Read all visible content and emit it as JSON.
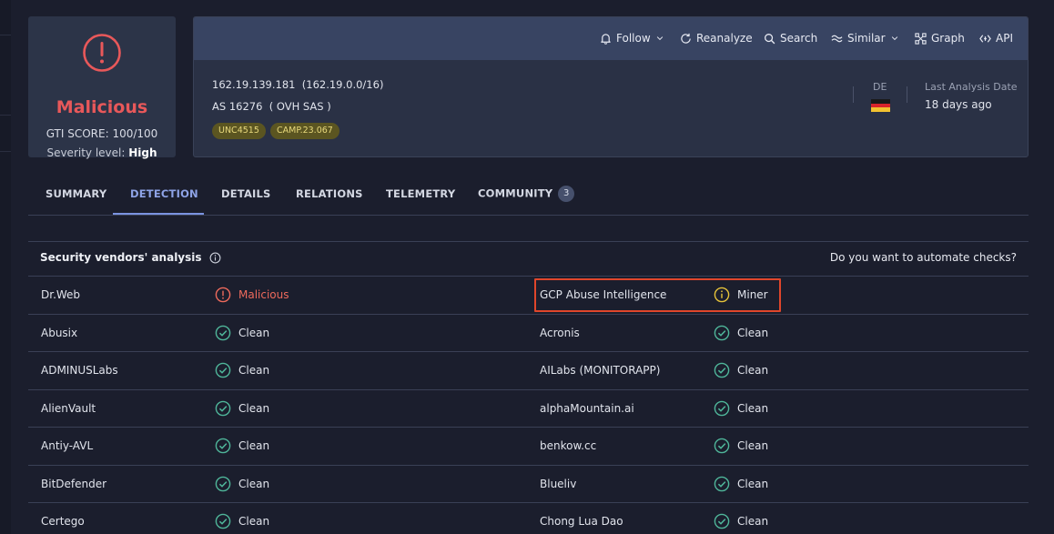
{
  "score_card": {
    "verdict": "Malicious",
    "gti_score": "GTI SCORE: 100/100",
    "severity_label": "Severity level:",
    "severity_value": "High",
    "accent_color": "#e8585a",
    "icon": "alert-circle-icon"
  },
  "toolbar": {
    "items": [
      {
        "label": "Follow",
        "icon": "bell-icon"
      },
      {
        "label": "Reanalyze",
        "icon": "refresh-icon"
      },
      {
        "label": "Search",
        "icon": "search-icon"
      },
      {
        "label": "Similar",
        "icon": "similar-icon"
      },
      {
        "label": "Graph",
        "icon": "graph-icon"
      },
      {
        "label": "API",
        "icon": "api-icon"
      }
    ]
  },
  "header": {
    "ip_line": "162.19.139.181  (162.19.0.0/16)",
    "as_line": "AS 16276  ( OVH SAS )",
    "tags": [
      "UNC4515",
      "CAMP.23.067"
    ],
    "country_code": "DE",
    "last_analysis_label": "Last Analysis Date",
    "last_analysis_value": "18 days ago"
  },
  "tabs": [
    {
      "label": "SUMMARY",
      "active": false
    },
    {
      "label": "DETECTION",
      "active": true
    },
    {
      "label": "DETAILS",
      "active": false
    },
    {
      "label": "RELATIONS",
      "active": false
    },
    {
      "label": "TELEMETRY",
      "active": false
    },
    {
      "label": "COMMUNITY",
      "active": false,
      "badge": "3"
    }
  ],
  "vendors": {
    "title": "Security vendors' analysis",
    "automate_link": "Do you want to automate checks?",
    "rows": [
      {
        "left": {
          "name": "Dr.Web",
          "result": "Malicious",
          "status": "malicious"
        },
        "right": {
          "name": "GCP Abuse Intelligence",
          "result": "Miner",
          "status": "suspicious"
        }
      },
      {
        "left": {
          "name": "Abusix",
          "result": "Clean",
          "status": "clean"
        },
        "right": {
          "name": "Acronis",
          "result": "Clean",
          "status": "clean"
        }
      },
      {
        "left": {
          "name": "ADMINUSLabs",
          "result": "Clean",
          "status": "clean"
        },
        "right": {
          "name": "AILabs (MONITORAPP)",
          "result": "Clean",
          "status": "clean"
        }
      },
      {
        "left": {
          "name": "AlienVault",
          "result": "Clean",
          "status": "clean"
        },
        "right": {
          "name": "alphaMountain.ai",
          "result": "Clean",
          "status": "clean"
        }
      },
      {
        "left": {
          "name": "Antiy-AVL",
          "result": "Clean",
          "status": "clean"
        },
        "right": {
          "name": "benkow.cc",
          "result": "Clean",
          "status": "clean"
        }
      },
      {
        "left": {
          "name": "BitDefender",
          "result": "Clean",
          "status": "clean"
        },
        "right": {
          "name": "Blueliv",
          "result": "Clean",
          "status": "clean"
        }
      },
      {
        "left": {
          "name": "Certego",
          "result": "Clean",
          "status": "clean"
        },
        "right": {
          "name": "Chong Lua Dao",
          "result": "Clean",
          "status": "clean"
        }
      }
    ]
  },
  "colors": {
    "malicious": "#ee6a5c",
    "clean": "#4fb69a",
    "suspicious": "#e6c33a",
    "highlight": "#e0462b"
  }
}
